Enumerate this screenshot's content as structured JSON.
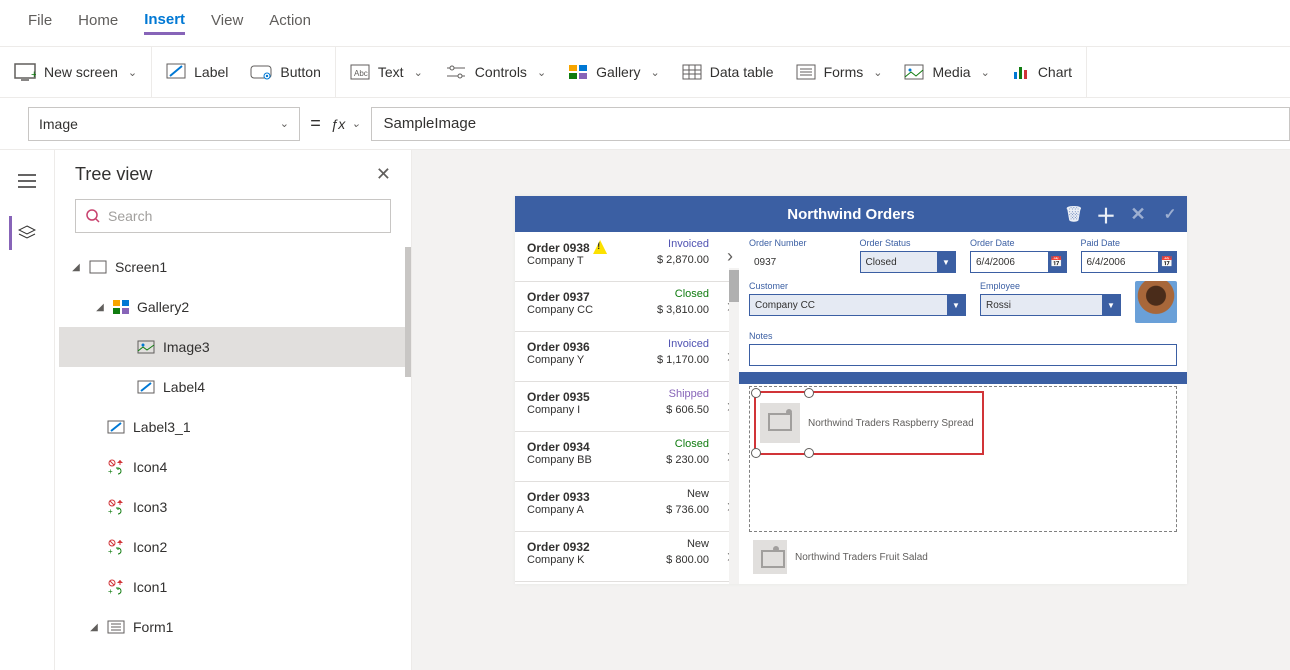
{
  "menu": {
    "file": "File",
    "home": "Home",
    "insert": "Insert",
    "view": "View",
    "action": "Action"
  },
  "ribbon": {
    "newScreen": "New screen",
    "label": "Label",
    "button": "Button",
    "text": "Text",
    "controls": "Controls",
    "gallery": "Gallery",
    "dataTable": "Data table",
    "forms": "Forms",
    "media": "Media",
    "chart": "Chart"
  },
  "formula": {
    "property": "Image",
    "value": "SampleImage"
  },
  "treeview": {
    "title": "Tree view",
    "searchPlaceholder": "Search",
    "screen1": "Screen1",
    "gallery2": "Gallery2",
    "image3": "Image3",
    "label4": "Label4",
    "label3_1": "Label3_1",
    "icon4": "Icon4",
    "icon3": "Icon3",
    "icon2": "Icon2",
    "icon1": "Icon1",
    "form1": "Form1"
  },
  "app": {
    "title": "Northwind Orders",
    "orders": [
      {
        "num": "Order 0938",
        "company": "Company T",
        "status": "Invoiced",
        "amount": "$ 2,870.00",
        "warn": true
      },
      {
        "num": "Order 0937",
        "company": "Company CC",
        "status": "Closed",
        "amount": "$ 3,810.00"
      },
      {
        "num": "Order 0936",
        "company": "Company Y",
        "status": "Invoiced",
        "amount": "$ 1,170.00"
      },
      {
        "num": "Order 0935",
        "company": "Company I",
        "status": "Shipped",
        "amount": "$ 606.50"
      },
      {
        "num": "Order 0934",
        "company": "Company BB",
        "status": "Closed",
        "amount": "$ 230.00"
      },
      {
        "num": "Order 0933",
        "company": "Company A",
        "status": "New",
        "amount": "$ 736.00"
      },
      {
        "num": "Order 0932",
        "company": "Company K",
        "status": "New",
        "amount": "$ 800.00"
      }
    ],
    "labels": {
      "orderNumber": "Order Number",
      "orderStatus": "Order Status",
      "orderDate": "Order Date",
      "paidDate": "Paid Date",
      "customer": "Customer",
      "employee": "Employee",
      "notes": "Notes"
    },
    "detail": {
      "orderNumber": "0937",
      "orderStatus": "Closed",
      "orderDate": "6/4/2006",
      "paidDate": "6/4/2006",
      "customer": "Company CC",
      "employee": "Rossi"
    },
    "lineItems": {
      "selected": "Northwind Traders Raspberry Spread",
      "next": "Northwind Traders Fruit Salad"
    }
  }
}
